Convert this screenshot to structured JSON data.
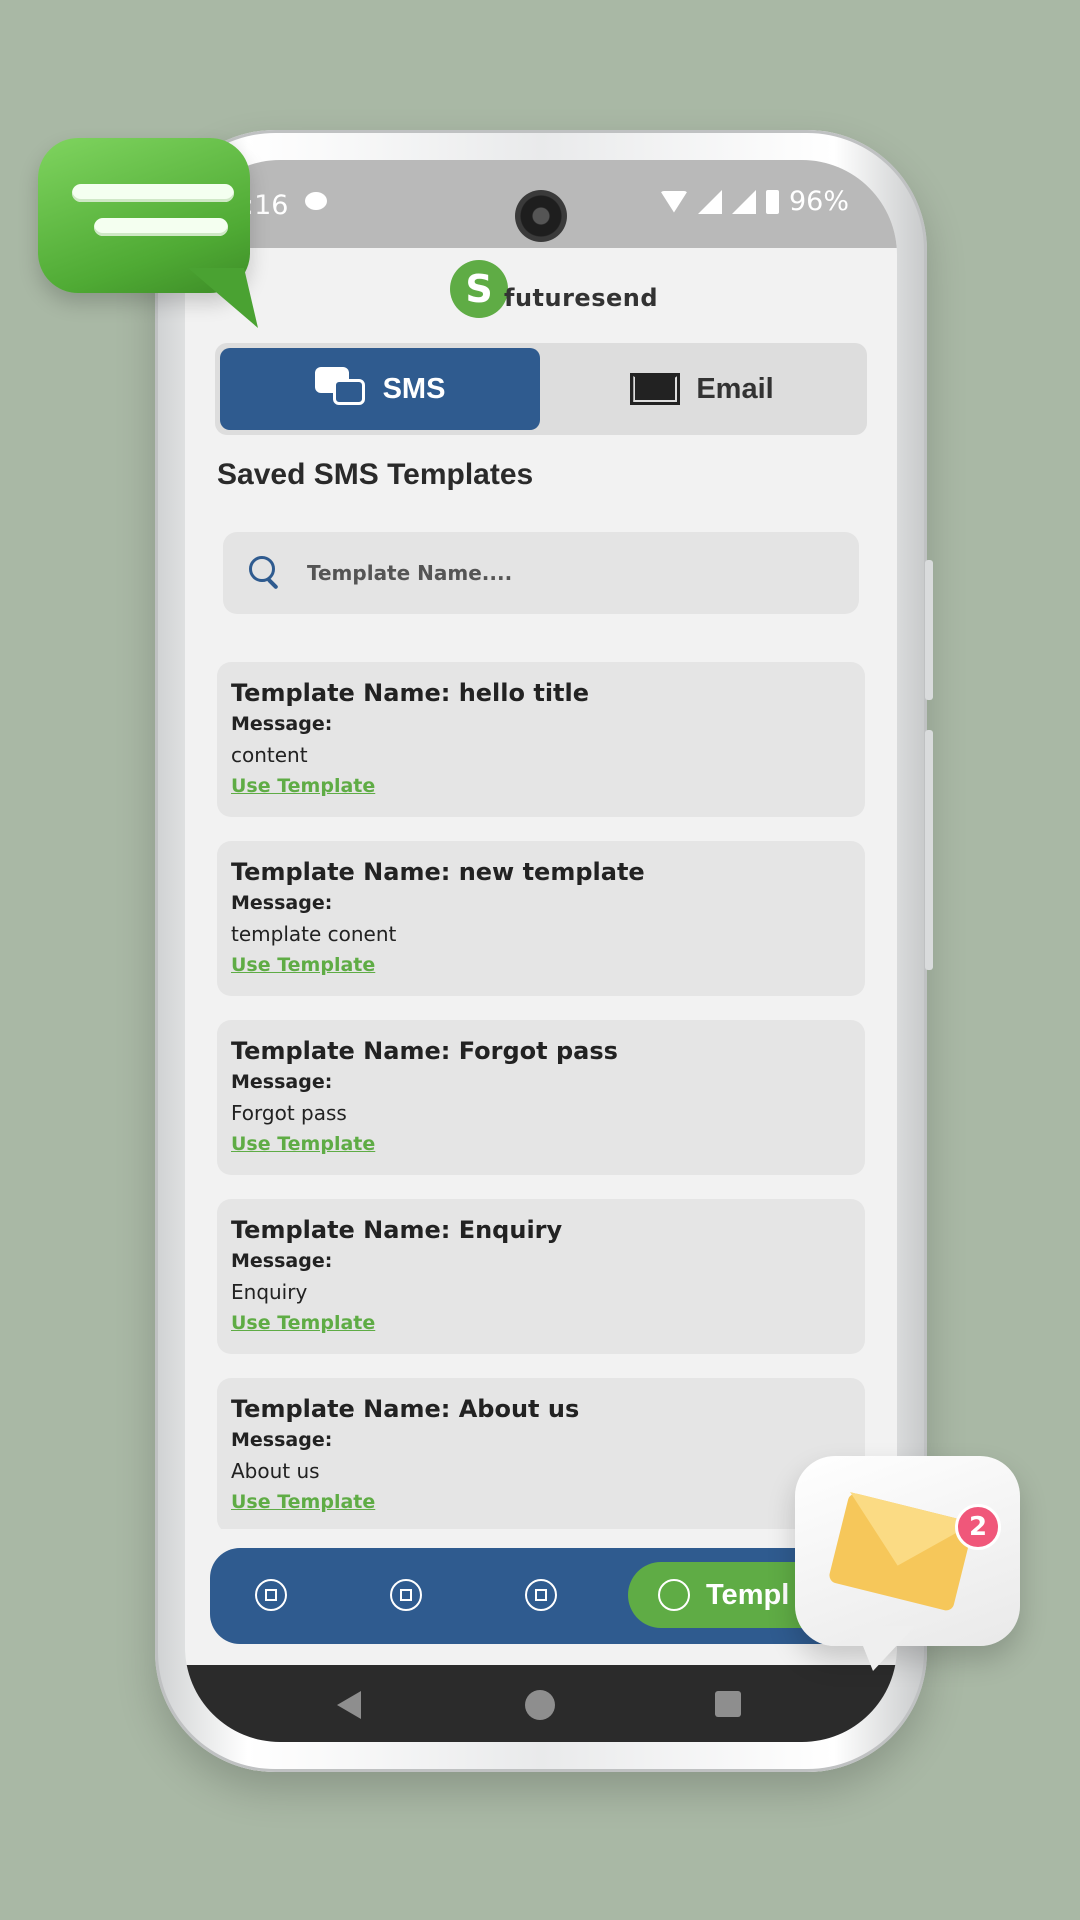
{
  "status_bar": {
    "time": ":16",
    "battery": "96%"
  },
  "app": {
    "logo_mark": "S",
    "logo_text": "futuresend"
  },
  "tabs": [
    {
      "label": "SMS",
      "icon": "chat-bubbles-icon",
      "active": true
    },
    {
      "label": "Email",
      "icon": "envelope-icon",
      "active": false
    }
  ],
  "section_title": "Saved SMS Templates",
  "search": {
    "placeholder": "Template Name...."
  },
  "templates": [
    {
      "title": "Template Name: hello title",
      "message_label": "Message:",
      "message": "content",
      "action": "Use Template"
    },
    {
      "title": "Template Name: new template",
      "message_label": "Message:",
      "message": "template conent",
      "action": "Use Template"
    },
    {
      "title": "Template Name: Forgot pass",
      "message_label": "Message:",
      "message": "Forgot pass",
      "action": "Use Template"
    },
    {
      "title": "Template Name: Enquiry",
      "message_label": "Message:",
      "message": "Enquiry",
      "action": "Use Template"
    },
    {
      "title": "Template Name: About us",
      "message_label": "Message:",
      "message": "About us",
      "action": "Use Template"
    }
  ],
  "bottom_nav": {
    "items": [
      "home-icon",
      "sms-icon",
      "email-icon"
    ],
    "active_label": "Templ"
  },
  "decor": {
    "mail_badge": "2"
  },
  "colors": {
    "primary": "#2f5b8f",
    "accent": "#5fac45",
    "background": "#a9b8a5"
  }
}
